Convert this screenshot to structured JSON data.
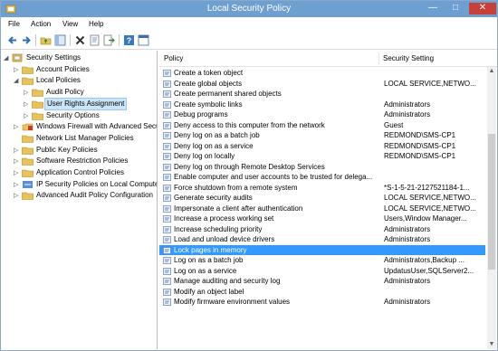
{
  "window": {
    "title": "Local Security Policy"
  },
  "menu": {
    "file": "File",
    "action": "Action",
    "view": "View",
    "help": "Help"
  },
  "toolbar": [
    "back-arrow-icon",
    "forward-arrow-icon",
    "up-folder-icon",
    "show-hide-tree-icon",
    "delete-icon",
    "properties-icon",
    "export-list-icon",
    "help-icon",
    "console-icon"
  ],
  "tree": [
    {
      "label": "Security Settings",
      "icon": "settings-icon",
      "depth": 0,
      "expander": "open"
    },
    {
      "label": "Account Policies",
      "icon": "folder-icon",
      "depth": 1,
      "expander": "closed"
    },
    {
      "label": "Local Policies",
      "icon": "folder-icon",
      "depth": 1,
      "expander": "open"
    },
    {
      "label": "Audit Policy",
      "icon": "folder-icon",
      "depth": 2,
      "expander": "closed"
    },
    {
      "label": "User Rights Assignment",
      "icon": "folder-icon",
      "depth": 2,
      "expander": "closed",
      "selected": true
    },
    {
      "label": "Security Options",
      "icon": "folder-icon",
      "depth": 2,
      "expander": "closed"
    },
    {
      "label": "Windows Firewall with Advanced Secu",
      "icon": "firewall-icon",
      "depth": 1,
      "expander": "closed"
    },
    {
      "label": "Network List Manager Policies",
      "icon": "folder-icon",
      "depth": 1,
      "expander": "none"
    },
    {
      "label": "Public Key Policies",
      "icon": "folder-icon",
      "depth": 1,
      "expander": "closed"
    },
    {
      "label": "Software Restriction Policies",
      "icon": "folder-icon",
      "depth": 1,
      "expander": "closed"
    },
    {
      "label": "Application Control Policies",
      "icon": "folder-icon",
      "depth": 1,
      "expander": "closed"
    },
    {
      "label": "IP Security Policies on Local Compute",
      "icon": "ip-security-icon",
      "depth": 1,
      "expander": "closed"
    },
    {
      "label": "Advanced Audit Policy Configuration",
      "icon": "folder-icon",
      "depth": 1,
      "expander": "closed"
    }
  ],
  "list": {
    "headers": {
      "policy": "Policy",
      "setting": "Security Setting"
    },
    "rows": [
      {
        "policy": "Create a token object",
        "setting": ""
      },
      {
        "policy": "Create global objects",
        "setting": "LOCAL SERVICE,NETWO..."
      },
      {
        "policy": "Create permanent shared objects",
        "setting": ""
      },
      {
        "policy": "Create symbolic links",
        "setting": "Administrators"
      },
      {
        "policy": "Debug programs",
        "setting": "Administrators"
      },
      {
        "policy": "Deny access to this computer from the network",
        "setting": "Guest"
      },
      {
        "policy": "Deny log on as a batch job",
        "setting": "REDMOND\\SMS-CP1"
      },
      {
        "policy": "Deny log on as a service",
        "setting": "REDMOND\\SMS-CP1"
      },
      {
        "policy": "Deny log on locally",
        "setting": "REDMOND\\SMS-CP1"
      },
      {
        "policy": "Deny log on through Remote Desktop Services",
        "setting": ""
      },
      {
        "policy": "Enable computer and user accounts to be trusted for delega...",
        "setting": ""
      },
      {
        "policy": "Force shutdown from a remote system",
        "setting": "*S-1-5-21-2127521184-1..."
      },
      {
        "policy": "Generate security audits",
        "setting": "LOCAL SERVICE,NETWO..."
      },
      {
        "policy": "Impersonate a client after authentication",
        "setting": "LOCAL SERVICE,NETWO..."
      },
      {
        "policy": "Increase a process working set",
        "setting": "Users,Window Manager..."
      },
      {
        "policy": "Increase scheduling priority",
        "setting": "Administrators"
      },
      {
        "policy": "Load and unload device drivers",
        "setting": "Administrators"
      },
      {
        "policy": "Lock pages in memory",
        "setting": "",
        "selected": true
      },
      {
        "policy": "Log on as a batch job",
        "setting": "Administrators,Backup ..."
      },
      {
        "policy": "Log on as a service",
        "setting": "UpdatusUser,SQLServer2..."
      },
      {
        "policy": "Manage auditing and security log",
        "setting": "Administrators"
      },
      {
        "policy": "Modify an object label",
        "setting": ""
      },
      {
        "policy": "Modify firmware environment values",
        "setting": "Administrators"
      }
    ]
  },
  "colors": {
    "title_bar": "#6d9fd0",
    "selection": "#3399ff",
    "tree_selection": "#cce4f7",
    "close_button": "#c7403a"
  }
}
